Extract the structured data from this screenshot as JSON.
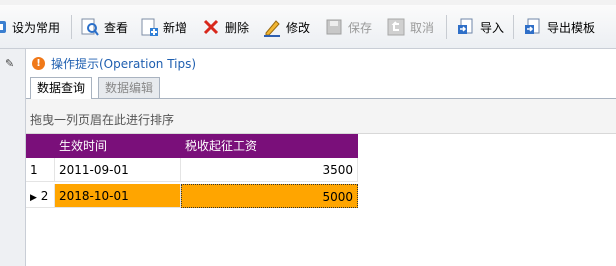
{
  "toolbar": {
    "buttons": [
      {
        "label": "设为常用",
        "icon": "set-favorite-icon",
        "enabled": true
      },
      {
        "label": "查看",
        "icon": "view-icon",
        "enabled": true
      },
      {
        "label": "新增",
        "icon": "add-icon",
        "enabled": true
      },
      {
        "label": "删除",
        "icon": "delete-icon",
        "enabled": true
      },
      {
        "label": "修改",
        "icon": "edit-icon",
        "enabled": true
      },
      {
        "label": "保存",
        "icon": "save-icon",
        "enabled": false
      },
      {
        "label": "取消",
        "icon": "cancel-icon",
        "enabled": false
      },
      {
        "label": "导入",
        "icon": "import-icon",
        "enabled": true
      },
      {
        "label": "导出模板",
        "icon": "export-template-icon",
        "enabled": true
      }
    ]
  },
  "tips": {
    "text": "操作提示(Operation Tips)"
  },
  "tabs": [
    {
      "label": "数据查询",
      "active": true
    },
    {
      "label": "数据编辑",
      "active": false
    }
  ],
  "group_panel": {
    "text": "拖曳一列页眉在此进行排序"
  },
  "grid": {
    "columns": [
      "生效时间",
      "税收起征工资"
    ],
    "rows": [
      {
        "index": "1",
        "date": "2011-09-01",
        "amount": "3500",
        "selected": false
      },
      {
        "index": "2",
        "date": "2018-10-01",
        "amount": "5000",
        "selected": true
      }
    ]
  },
  "colors": {
    "header_bg": "#7a0f7a",
    "selected_row": "#ffa500",
    "tips_text": "#1f5fb0"
  }
}
